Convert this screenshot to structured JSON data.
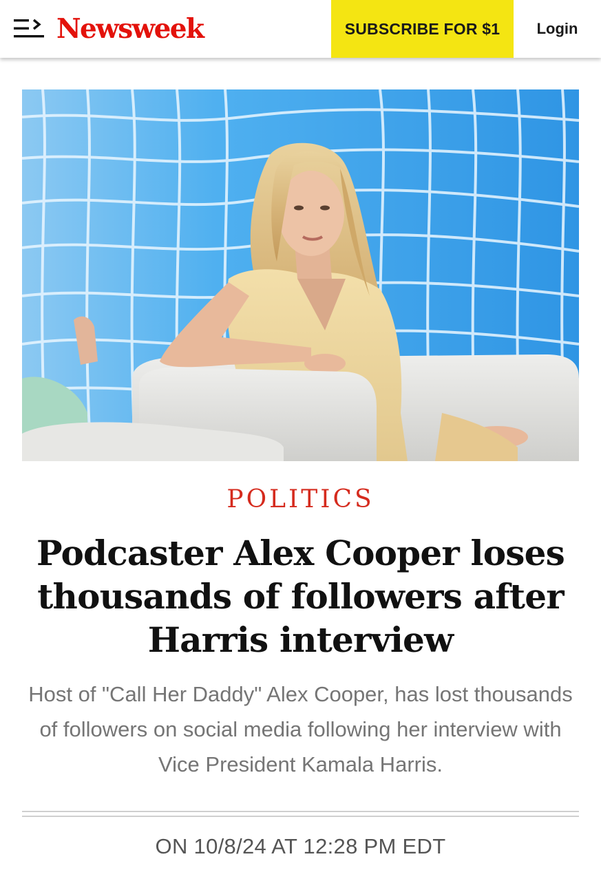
{
  "header": {
    "logo_text": "Newsweek",
    "subscribe_label": "SUBSCRIBE FOR $1",
    "login_label": "Login",
    "menu_icon": "menu-icon",
    "brand_color": "#e3120b",
    "subscribe_color": "#f4e512"
  },
  "article": {
    "category": "POLITICS",
    "headline": "Podcaster Alex Cooper loses thousands of followers after Harris interview",
    "dek": "Host of \"Call Her Daddy\" Alex Cooper, has lost thousands of followers on social media following her interview with Vice President Kamala Harris.",
    "dateline": "ON 10/8/24 AT 12:28 PM EDT",
    "category_color": "#d52b1e"
  }
}
